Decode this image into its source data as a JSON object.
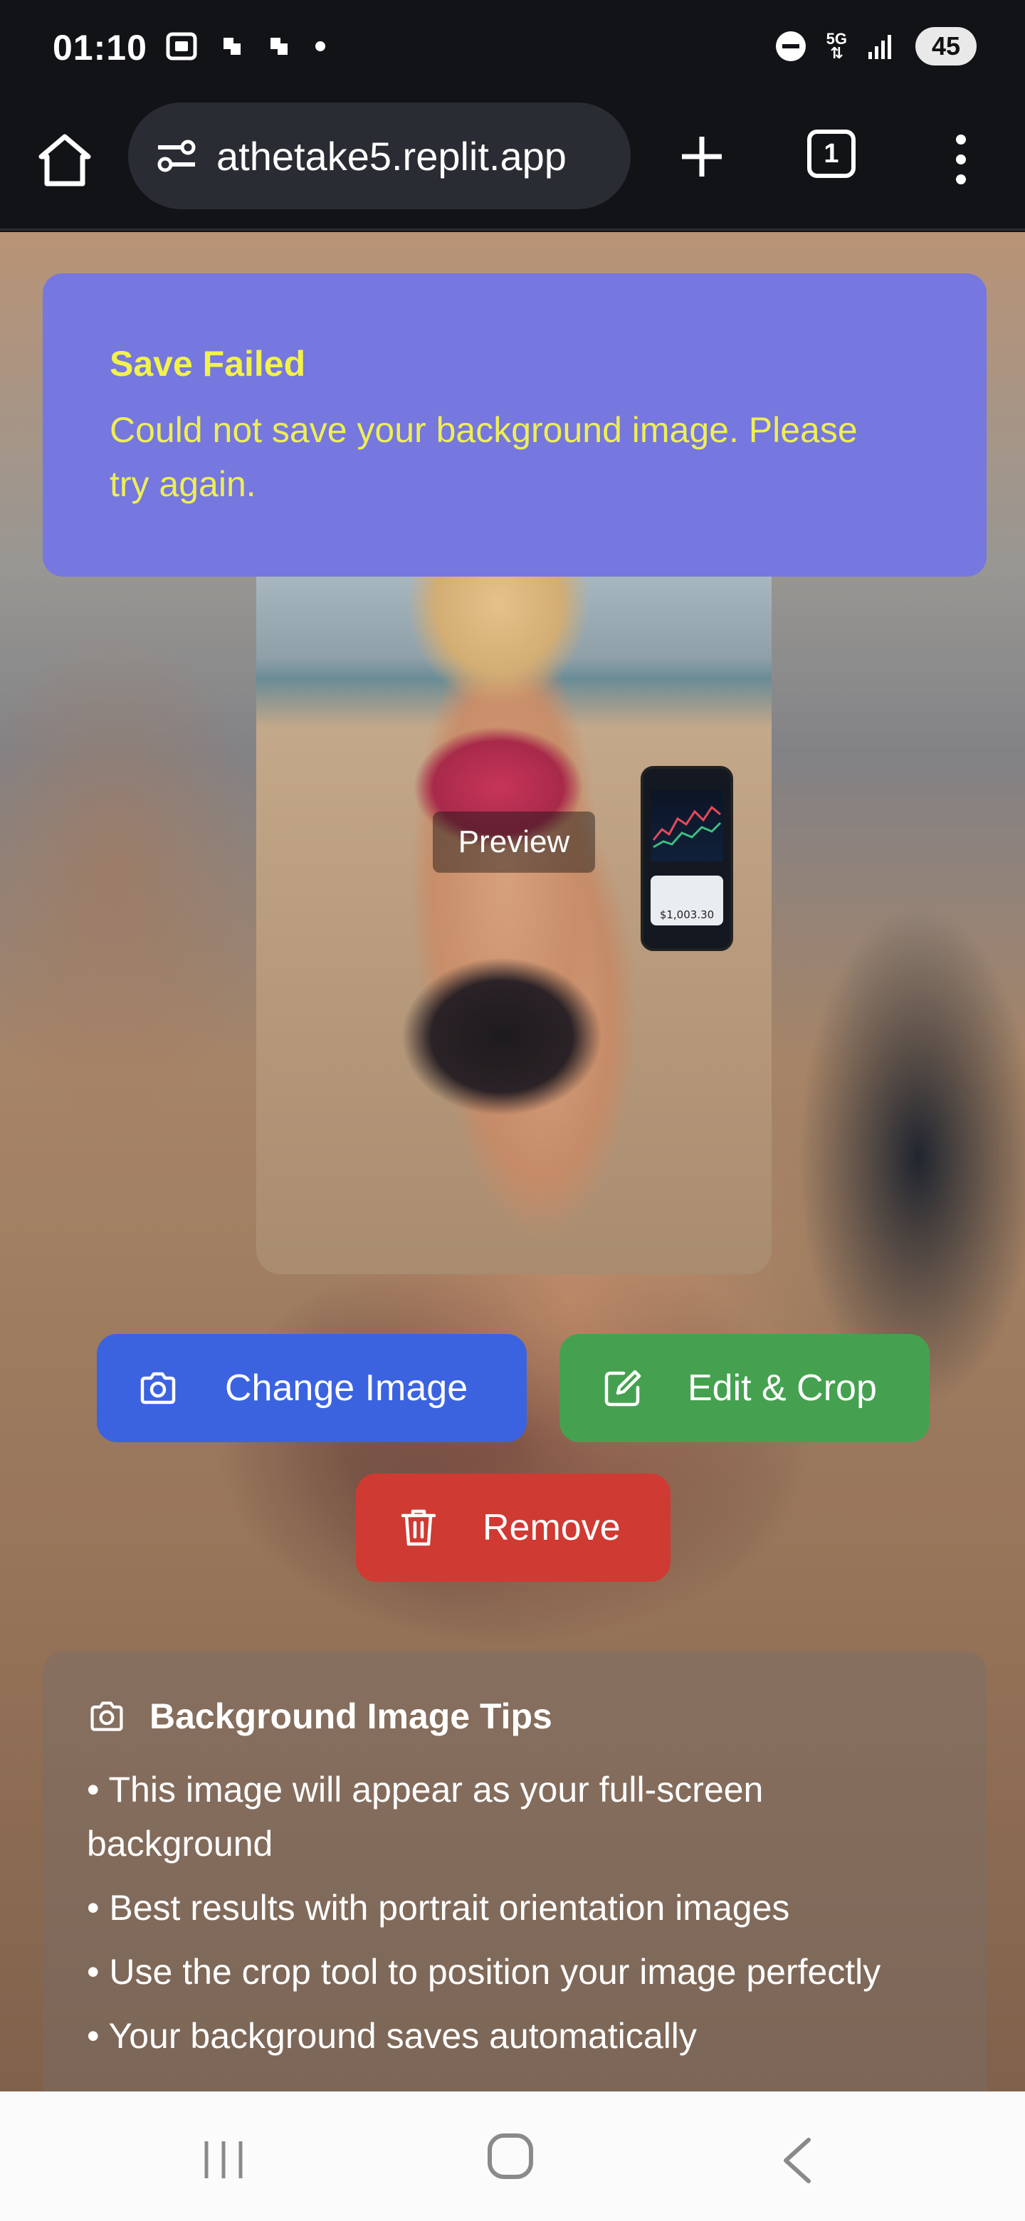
{
  "status_bar": {
    "time": "01:10",
    "network": "5G",
    "battery": "45"
  },
  "browser": {
    "url": "athetake5.replit.app",
    "tab_count": "1"
  },
  "toast": {
    "title": "Save Failed",
    "message": "Could not save your background image. Please try again.",
    "background_color": "#7677df",
    "text_color": "#eeee55"
  },
  "preview": {
    "label": "Preview",
    "phone_amount": "$1,003.30"
  },
  "actions": {
    "change_image": "Change Image",
    "edit_crop": "Edit & Crop",
    "remove": "Remove",
    "colors": {
      "change": "#3b63e0",
      "edit": "#45a150",
      "remove": "#cf3a33"
    }
  },
  "tips": {
    "title": "Background Image Tips",
    "items": [
      "• This image will appear as your full-screen background",
      "• Best results with portrait orientation images",
      "• Use the crop tool to position your image perfectly",
      "• Your background saves automatically"
    ]
  },
  "icons": {
    "home": "home-icon",
    "site_settings": "tune-icon",
    "new_tab": "plus-icon",
    "tabs": "tab-count-icon",
    "menu": "more-vert-icon",
    "camera": "camera-icon",
    "edit": "edit-icon",
    "trash": "trash-icon"
  }
}
